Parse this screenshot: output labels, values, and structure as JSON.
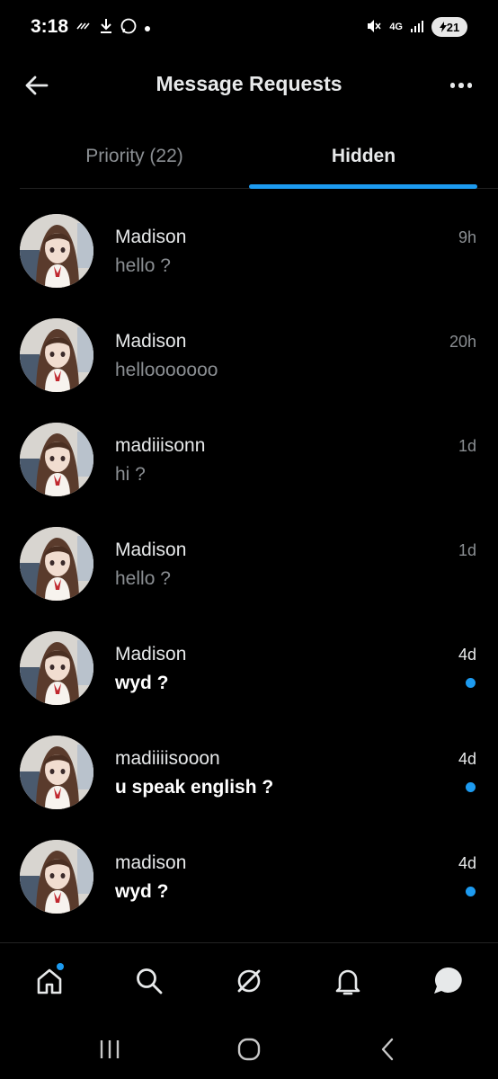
{
  "status_bar": {
    "time": "3:18",
    "network": "4G",
    "battery": "21"
  },
  "header": {
    "title": "Message Requests"
  },
  "tabs": [
    {
      "label": "Priority (22)",
      "active": false
    },
    {
      "label": "Hidden",
      "active": true
    }
  ],
  "conversations": [
    {
      "name": "Madison",
      "preview": "hello ?",
      "time": "9h",
      "unread": false
    },
    {
      "name": "Madison",
      "preview": "hellooooooo",
      "time": "20h",
      "unread": false
    },
    {
      "name": "madiiisonn",
      "preview": "hi ?",
      "time": "1d",
      "unread": false
    },
    {
      "name": "Madison",
      "preview": "hello ?",
      "time": "1d",
      "unread": false
    },
    {
      "name": "Madison",
      "preview": "wyd ?",
      "time": "4d",
      "unread": true
    },
    {
      "name": "madiiiisooon",
      "preview": "u speak english ?",
      "time": "4d",
      "unread": true
    },
    {
      "name": "madison",
      "preview": "wyd ?",
      "time": "4d",
      "unread": true
    }
  ],
  "bottom_nav": [
    {
      "icon": "home-icon",
      "badge": true
    },
    {
      "icon": "search-icon",
      "badge": false
    },
    {
      "icon": "grok-icon",
      "badge": false
    },
    {
      "icon": "bell-icon",
      "badge": false
    },
    {
      "icon": "messages-icon",
      "badge": false
    }
  ],
  "system_nav": [
    {
      "icon": "recent-apps-icon"
    },
    {
      "icon": "home-circle-icon"
    },
    {
      "icon": "back-chevron-icon"
    }
  ],
  "colors": {
    "accent": "#1d9bf0",
    "background": "#000000",
    "secondary_text": "#8b8f93"
  }
}
